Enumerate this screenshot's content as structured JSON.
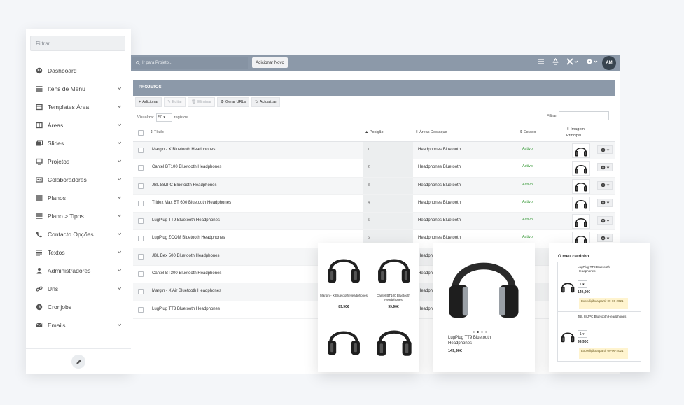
{
  "sidebar": {
    "filter_placeholder": "Filtrar...",
    "items": [
      {
        "label": "Dashboard",
        "icon": "palette-icon",
        "chevron": false
      },
      {
        "label": "Itens de Menu",
        "icon": "list-icon",
        "chevron": true
      },
      {
        "label": "Templates Área",
        "icon": "template-icon",
        "chevron": true
      },
      {
        "label": "Áreas",
        "icon": "columns-icon",
        "chevron": true
      },
      {
        "label": "Slides",
        "icon": "images-icon",
        "chevron": true
      },
      {
        "label": "Projetos",
        "icon": "monitor-icon",
        "chevron": true
      },
      {
        "label": "Colaboradores",
        "icon": "id-card-icon",
        "chevron": true
      },
      {
        "label": "Planos",
        "icon": "list-icon",
        "chevron": true
      },
      {
        "label": "Plano > Tipos",
        "icon": "list-icon",
        "chevron": true
      },
      {
        "label": "Contacto Opções",
        "icon": "phone-icon",
        "chevron": true
      },
      {
        "label": "Textos",
        "icon": "text-icon",
        "chevron": true
      },
      {
        "label": "Administradores",
        "icon": "user-icon",
        "chevron": true
      },
      {
        "label": "Urls",
        "icon": "link-icon",
        "chevron": true
      },
      {
        "label": "Cronjobs",
        "icon": "clock-icon",
        "chevron": false
      },
      {
        "label": "Emails",
        "icon": "envelope-icon",
        "chevron": true
      }
    ]
  },
  "topbar": {
    "search_placeholder": "Ir para Projeto...",
    "add_new": "Adicionar Novo",
    "avatar": "AM"
  },
  "panel": {
    "title": "PROJETOS",
    "actions": [
      {
        "label": "Adicionar",
        "icon": "+",
        "disabled": false
      },
      {
        "label": "Editar",
        "icon": "✎",
        "disabled": true
      },
      {
        "label": "Eliminar",
        "icon": "🗑",
        "disabled": true
      },
      {
        "label": "Gerar URLs",
        "icon": "⚙",
        "disabled": false
      },
      {
        "label": "Actualizar",
        "icon": "↻",
        "disabled": false
      }
    ],
    "visualizar": "Visualizar",
    "page_size": "50",
    "registos": "registos",
    "filtrar": "Filtrar",
    "columns": {
      "titulo": "Título",
      "posicao": "Posição",
      "areas": "Áreas Destaque",
      "estado": "Estado",
      "imagem": "Imagem Principal"
    },
    "rows": [
      {
        "title": "Margin - X Bluetooth Headphones",
        "pos": "1",
        "area": "Headphones Bluetooth",
        "state": "Activo"
      },
      {
        "title": "Cantel BT100 Bluetooth Headphones",
        "pos": "2",
        "area": "Headphones Bluetooth",
        "state": "Activo"
      },
      {
        "title": "JBL 88JPC Bluetooth Headphones",
        "pos": "3",
        "area": "Headphones Bluetooth",
        "state": "Activo"
      },
      {
        "title": "Tridex Max BT 600 Bluetooth Headphones",
        "pos": "4",
        "area": "Headphones Bluetooth",
        "state": "Activo"
      },
      {
        "title": "LugPlug TT9 Bluetooth Headphones",
        "pos": "5",
        "area": "Headphones Bluetooth",
        "state": "Activo"
      },
      {
        "title": "LugPlug ZOOM Bluetooth Headphones",
        "pos": "6",
        "area": "Headphones Bluetooth",
        "state": "Activo"
      },
      {
        "title": "JBL Bex 500 Bluetooth Headphones",
        "pos": "",
        "area": "Headph",
        "state": ""
      },
      {
        "title": "Cantel BT300 Bluetooth Headphones",
        "pos": "",
        "area": "Headph",
        "state": ""
      },
      {
        "title": "Margin - X Air Bluetooth Headphones",
        "pos": "",
        "area": "Headph",
        "state": ""
      },
      {
        "title": "LugPlug TT3 Bluetooth Headphones",
        "pos": "",
        "area": "Headph",
        "state": ""
      }
    ]
  },
  "grid_card": {
    "products": [
      {
        "name": "Margin - X Bluetooth Headphones",
        "price": "89,90€"
      },
      {
        "name": "Cantel BT100 Bluetooth Headphones",
        "price": "99,90€"
      },
      {
        "name": "",
        "price": ""
      },
      {
        "name": "",
        "price": ""
      }
    ]
  },
  "detail_card": {
    "name": "LugPlug TT9 Bluetooth Headphones",
    "price": "149,90€"
  },
  "cart_card": {
    "title": "O meu carrinho",
    "items": [
      {
        "name": "LugPlug TT9 Bluetooth Headphones",
        "qty": "1",
        "price": "149,90€",
        "ship": "Expedição a partir 09-06-2021"
      },
      {
        "name": "JBL 88JPC Bluetooth Headphones",
        "qty": "1",
        "price": "99,90€",
        "ship": "Expedição a partir 09-06-2021"
      }
    ]
  },
  "colors": {
    "topbar": "#8c99a9",
    "active_green": "#3a9b3a",
    "ship_bg": "#fff4cf"
  }
}
